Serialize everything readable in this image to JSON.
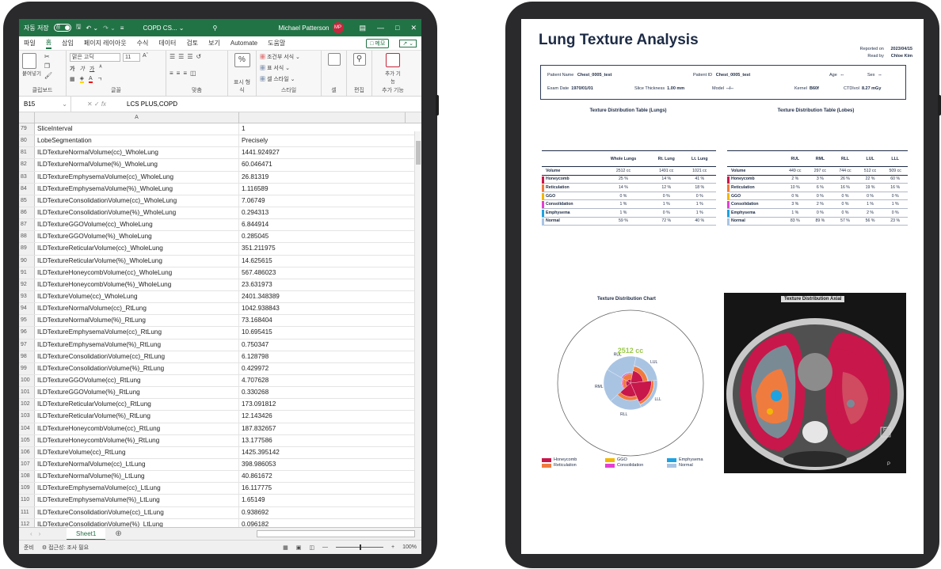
{
  "excel": {
    "title": {
      "autosave_label": "자동 저장",
      "toggle_state": "끔",
      "doc_name": "COPD CS...",
      "user_name": "Michael Patterson",
      "user_initials": "MP"
    },
    "menu": [
      "파일",
      "홈",
      "삽입",
      "페이지 레이아웃",
      "수식",
      "데이터",
      "검토",
      "보기",
      "Automate",
      "도움말"
    ],
    "memo_label": "메모",
    "ribbon": {
      "clipboard": {
        "label": "클립보드",
        "paste": "붙여넣기"
      },
      "font": {
        "label": "글꼴",
        "font_name": "맑은 고딕",
        "font_size": "11",
        "bold": "가",
        "italic": "가",
        "underline": "가"
      },
      "align": {
        "label": "맞춤"
      },
      "number": {
        "label": "표시 형식",
        "percent": "%"
      },
      "styles": {
        "label": "스타일",
        "cond": "조건부 서식",
        "table": "표 서식",
        "cell": "셀 스타일"
      },
      "cells": {
        "label": "셀"
      },
      "editing": {
        "label": "편집"
      },
      "addins": {
        "label": "추가 기능",
        "btn": "추가 기능"
      }
    },
    "name_box": "B15",
    "fx": "fx",
    "formula": "LCS PLUS,COPD",
    "col_header_a": "A",
    "rows": [
      {
        "n": "79",
        "a": "SliceInterval",
        "b": "1"
      },
      {
        "n": "80",
        "a": "LobeSegmentation",
        "b": "Precisely"
      },
      {
        "n": "81",
        "a": "ILDTextureNormalVolume(cc)_WholeLung",
        "b": "1441.924927"
      },
      {
        "n": "82",
        "a": "ILDTextureNormalVolume(%)_WholeLung",
        "b": "60.046471"
      },
      {
        "n": "83",
        "a": "ILDTextureEmphysemaVolume(cc)_WholeLung",
        "b": "26.81319"
      },
      {
        "n": "84",
        "a": "ILDTextureEmphysemaVolume(%)_WholeLung",
        "b": "1.116589"
      },
      {
        "n": "85",
        "a": "ILDTextureConsolidationVolume(cc)_WholeLung",
        "b": "7.06749"
      },
      {
        "n": "86",
        "a": "ILDTextureConsolidationVolume(%)_WholeLung",
        "b": "0.294313"
      },
      {
        "n": "87",
        "a": "ILDTextureGGOVolume(cc)_WholeLung",
        "b": "6.844914"
      },
      {
        "n": "88",
        "a": "ILDTextureGGOVolume(%)_WholeLung",
        "b": "0.285045"
      },
      {
        "n": "89",
        "a": "ILDTextureReticularVolume(cc)_WholeLung",
        "b": "351.211975"
      },
      {
        "n": "90",
        "a": "ILDTextureReticularVolume(%)_WholeLung",
        "b": "14.625615"
      },
      {
        "n": "91",
        "a": "ILDTextureHoneycombVolume(cc)_WholeLung",
        "b": "567.486023"
      },
      {
        "n": "92",
        "a": "ILDTextureHoneycombVolume(%)_WholeLung",
        "b": "23.631973"
      },
      {
        "n": "93",
        "a": "ILDTextureVolume(cc)_WholeLung",
        "b": "2401.348389"
      },
      {
        "n": "94",
        "a": "ILDTextureNormalVolume(cc)_RtLung",
        "b": "1042.938843"
      },
      {
        "n": "95",
        "a": "ILDTextureNormalVolume(%)_RtLung",
        "b": "73.168404"
      },
      {
        "n": "96",
        "a": "ILDTextureEmphysemaVolume(cc)_RtLung",
        "b": "10.695415"
      },
      {
        "n": "97",
        "a": "ILDTextureEmphysemaVolume(%)_RtLung",
        "b": "0.750347"
      },
      {
        "n": "98",
        "a": "ILDTextureConsolidationVolume(cc)_RtLung",
        "b": "6.128798"
      },
      {
        "n": "99",
        "a": "ILDTextureConsolidationVolume(%)_RtLung",
        "b": "0.429972"
      },
      {
        "n": "100",
        "a": "ILDTextureGGOVolume(cc)_RtLung",
        "b": "4.707628"
      },
      {
        "n": "101",
        "a": "ILDTextureGGOVolume(%)_RtLung",
        "b": "0.330268"
      },
      {
        "n": "102",
        "a": "ILDTextureReticularVolume(cc)_RtLung",
        "b": "173.091812"
      },
      {
        "n": "103",
        "a": "ILDTextureReticularVolume(%)_RtLung",
        "b": "12.143426"
      },
      {
        "n": "104",
        "a": "ILDTextureHoneycombVolume(cc)_RtLung",
        "b": "187.832657"
      },
      {
        "n": "105",
        "a": "ILDTextureHoneycombVolume(%)_RtLung",
        "b": "13.177586"
      },
      {
        "n": "106",
        "a": "ILDTextureVolume(cc)_RtLung",
        "b": "1425.395142"
      },
      {
        "n": "107",
        "a": "ILDTextureNormalVolume(cc)_LtLung",
        "b": "398.986053"
      },
      {
        "n": "108",
        "a": "ILDTextureNormalVolume(%)_LtLung",
        "b": "40.861672"
      },
      {
        "n": "109",
        "a": "ILDTextureEmphysemaVolume(cc)_LtLung",
        "b": "16.117775"
      },
      {
        "n": "110",
        "a": "ILDTextureEmphysemaVolume(%)_LtLung",
        "b": "1.65149"
      },
      {
        "n": "111",
        "a": "ILDTextureConsolidationVolume(cc)_LtLung",
        "b": "0.938692"
      },
      {
        "n": "112",
        "a": "ILDTextureConsolidationVolume(%)_LtLung",
        "b": "0.096182"
      }
    ],
    "sheet_tab": "Sheet1",
    "status_left": "준비",
    "status_access": "접근성: 조사 필요",
    "zoom": "100%"
  },
  "report": {
    "title": "Lung Texture Analysis",
    "reported_on_label": "Reported on",
    "reported_on": "2023/04/15",
    "read_by_label": "Read by",
    "read_by": "Chloe Kim",
    "patient": {
      "name_label": "Patient Name",
      "name": "Chest_0005_test",
      "id_label": "Patient ID",
      "id": "Chest_0005_test",
      "age_label": "Age",
      "age": "--",
      "sex_label": "Sex",
      "sex": "--",
      "exam_label": "Exam Date",
      "exam": "1970/01/01",
      "slice_label": "Slice Thickness",
      "slice": "1.00 mm",
      "model_label": "Model",
      "model": "--/--",
      "kernel_label": "Kernel",
      "kernel": "B60f",
      "ctdi_label": "CTDIvol",
      "ctdi": "8.27 mGy"
    },
    "lungs_table": {
      "caption": "Texture Distribution Table (Lungs)",
      "headers": [
        "",
        "Whole Lungs",
        "Rt. Lung",
        "Lt. Lung"
      ],
      "rows": [
        {
          "label": "Volume",
          "vals": [
            "2512 cc",
            "1491 cc",
            "1021 cc"
          ],
          "color": ""
        },
        {
          "label": "Honeycomb",
          "vals": [
            "25 %",
            "14 %",
            "41 %"
          ],
          "color": "#c8174b"
        },
        {
          "label": "Reticulation",
          "vals": [
            "14 %",
            "12 %",
            "18 %"
          ],
          "color": "#f07b3f"
        },
        {
          "label": "GGO",
          "vals": [
            "0 %",
            "0 %",
            "0 %"
          ],
          "color": "#f2b705"
        },
        {
          "label": "Consolidation",
          "vals": [
            "1 %",
            "1 %",
            "1 %"
          ],
          "color": "#e43fd4"
        },
        {
          "label": "Emphysema",
          "vals": [
            "1 %",
            "0 %",
            "1 %"
          ],
          "color": "#1fa2e0"
        },
        {
          "label": "Normal",
          "vals": [
            "59 %",
            "72 %",
            "40 %"
          ],
          "color": "#a9c4e3"
        }
      ]
    },
    "lobes_table": {
      "caption": "Texture Distribution Table (Lobes)",
      "headers": [
        "",
        "RUL",
        "RML",
        "RLL",
        "LUL",
        "LLL"
      ],
      "rows": [
        {
          "label": "Volume",
          "vals": [
            "449 cc",
            "297 cc",
            "744 cc",
            "512 cc",
            "509 cc"
          ],
          "color": ""
        },
        {
          "label": "Honeycomb",
          "vals": [
            "2 %",
            "3 %",
            "26 %",
            "22 %",
            "60 %"
          ],
          "color": "#c8174b"
        },
        {
          "label": "Reticulation",
          "vals": [
            "10 %",
            "6 %",
            "16 %",
            "19 %",
            "16 %"
          ],
          "color": "#f07b3f"
        },
        {
          "label": "GGO",
          "vals": [
            "0 %",
            "0 %",
            "0 %",
            "0 %",
            "0 %"
          ],
          "color": "#f2b705"
        },
        {
          "label": "Consolidation",
          "vals": [
            "3 %",
            "2 %",
            "0 %",
            "1 %",
            "1 %"
          ],
          "color": "#e43fd4"
        },
        {
          "label": "Emphysema",
          "vals": [
            "1 %",
            "0 %",
            "0 %",
            "2 %",
            "0 %"
          ],
          "color": "#1fa2e0"
        },
        {
          "label": "Normal",
          "vals": [
            "83 %",
            "89 %",
            "57 %",
            "56 %",
            "23 %"
          ],
          "color": "#a9c4e3"
        }
      ]
    },
    "chart_caption": "Texture Distribution Chart",
    "chart_center_value": "2512 cc",
    "lobe_labels": [
      "RUL",
      "LUL",
      "RML",
      "LLL",
      "RLL"
    ],
    "axial_caption": "Texture Distribution Axial",
    "axial_orient": "P",
    "axial_marker": "F",
    "legend": [
      {
        "label": "Honeycomb",
        "color": "#c8174b"
      },
      {
        "label": "Reticulation",
        "color": "#f07b3f"
      },
      {
        "label": "GGO",
        "color": "#f2b705"
      },
      {
        "label": "Consolidation",
        "color": "#e43fd4"
      },
      {
        "label": "Emphysema",
        "color": "#1fa2e0"
      },
      {
        "label": "Normal",
        "color": "#a9c4e3"
      }
    ]
  }
}
